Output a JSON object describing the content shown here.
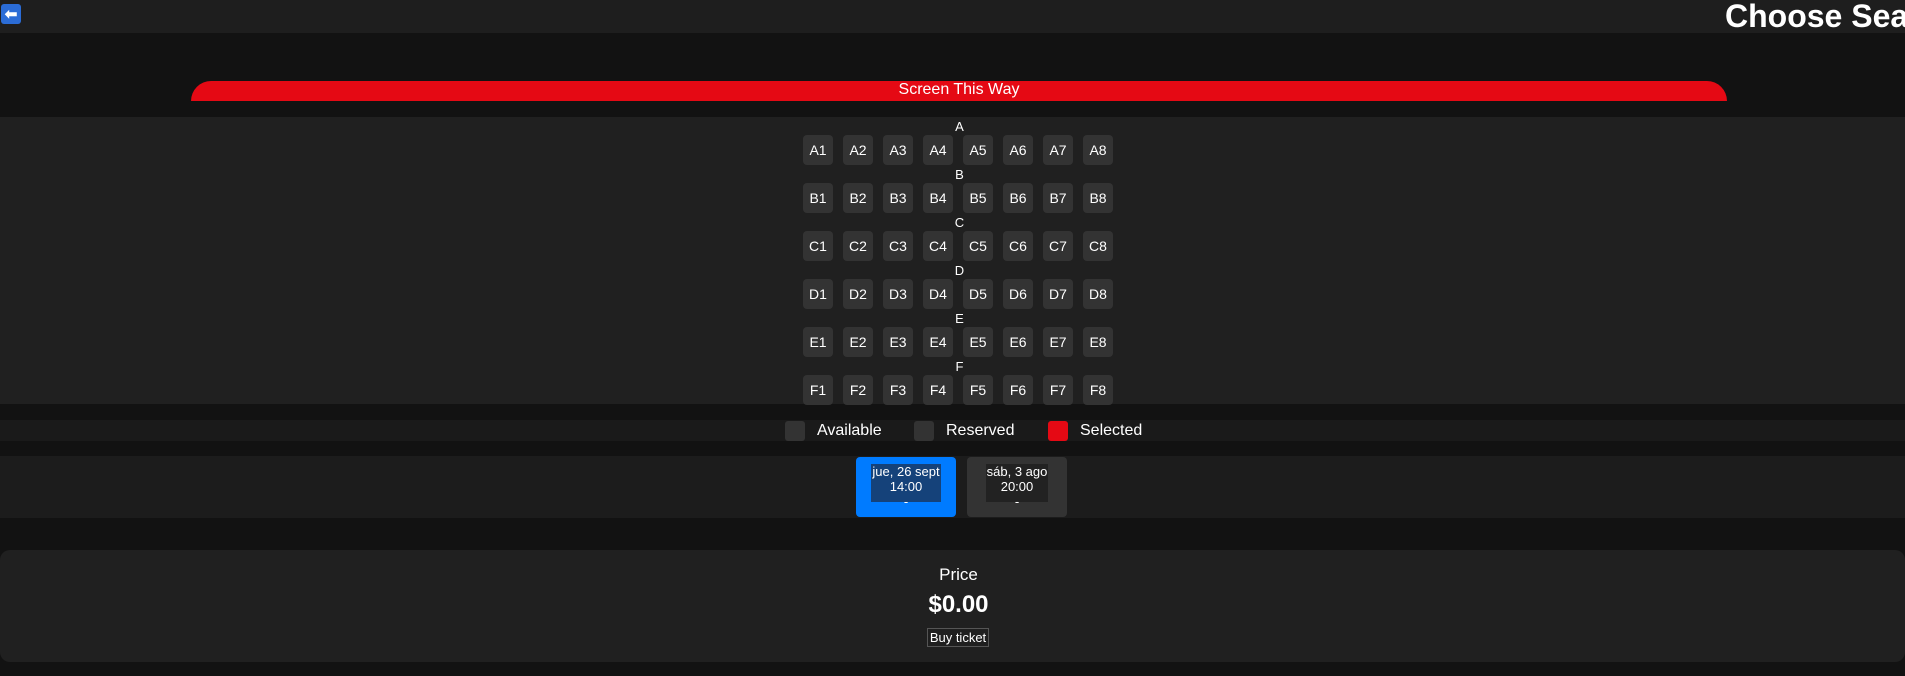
{
  "header": {
    "back_icon": "back-arrow-icon",
    "back_glyph": "⬅",
    "title": "Choose Seat"
  },
  "screen": {
    "label": "Screen This Way"
  },
  "rows": [
    {
      "label": "A",
      "seats": [
        "A1",
        "A2",
        "A3",
        "A4",
        "A5",
        "A6",
        "A7",
        "A8"
      ]
    },
    {
      "label": "B",
      "seats": [
        "B1",
        "B2",
        "B3",
        "B4",
        "B5",
        "B6",
        "B7",
        "B8"
      ]
    },
    {
      "label": "C",
      "seats": [
        "C1",
        "C2",
        "C3",
        "C4",
        "C5",
        "C6",
        "C7",
        "C8"
      ]
    },
    {
      "label": "D",
      "seats": [
        "D1",
        "D2",
        "D3",
        "D4",
        "D5",
        "D6",
        "D7",
        "D8"
      ]
    },
    {
      "label": "E",
      "seats": [
        "E1",
        "E2",
        "E3",
        "E4",
        "E5",
        "E6",
        "E7",
        "E8"
      ]
    },
    {
      "label": "F",
      "seats": [
        "F1",
        "F2",
        "F3",
        "F4",
        "F5",
        "F6",
        "F7",
        "F8"
      ]
    }
  ],
  "legend": [
    {
      "label": "Available",
      "color": "#333333"
    },
    {
      "label": "Reserved",
      "color": "#333333"
    },
    {
      "label": "Selected",
      "color": "#e50914"
    }
  ],
  "showtimes": [
    {
      "date": "jue, 26 sept",
      "time": "14:00",
      "extra": "-",
      "active": true
    },
    {
      "date": "sáb, 3 ago",
      "time": "20:00",
      "extra": "-",
      "active": false
    }
  ],
  "price": {
    "label": "Price",
    "value": "$0.00",
    "buy_label": "Buy ticket"
  },
  "colors": {
    "accent": "#e50914",
    "active_date": "#007bff",
    "seat": "#333333"
  }
}
